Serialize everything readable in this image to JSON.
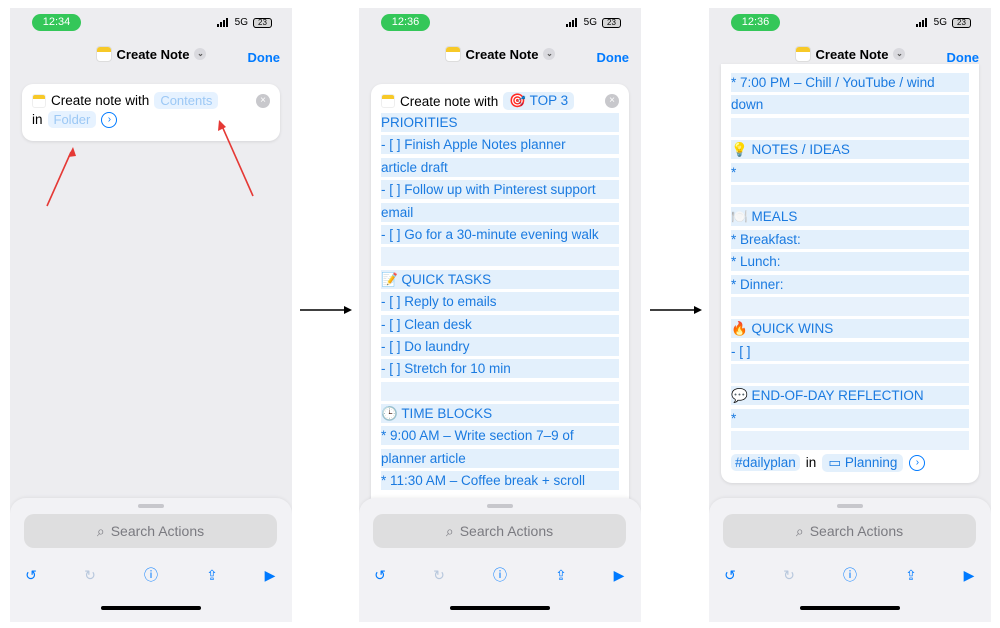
{
  "status": {
    "network": "5G",
    "battery": "23"
  },
  "title": "Create Note",
  "done_label": "Done",
  "search_placeholder": "Search Actions",
  "screens": [
    {
      "time": "12:34",
      "action": {
        "prefix": "Create note with",
        "contents": "Contents",
        "in_label": "in",
        "folder": "Folder"
      }
    },
    {
      "time": "12:36",
      "action": {
        "prefix": "Create note with",
        "first_emoji": "🎯",
        "first_token": "TOP 3"
      },
      "lines": [
        "PRIORITIES",
        "- [ ] Finish Apple Notes planner",
        "article draft",
        "- [ ] Follow up with Pinterest support",
        "email",
        "- [ ] Go for a 30-minute evening walk",
        "",
        "📝 QUICK TASKS",
        "- [ ] Reply to emails",
        "- [ ] Clean desk",
        "- [ ] Do laundry",
        "- [ ] Stretch for 10 min",
        "",
        "🕒 TIME BLOCKS",
        "* 9:00 AM – Write section 7–9 of",
        "planner article",
        "* 11:30 AM – Coffee break + scroll"
      ]
    },
    {
      "time": "12:36",
      "lines": [
        "* 7:00 PM – Chill / YouTube / wind",
        "down",
        "",
        "💡 NOTES / IDEAS",
        "*",
        "",
        "🍽️ MEALS",
        "* Breakfast:",
        "* Lunch:",
        "* Dinner:",
        "",
        "🔥 QUICK WINS",
        "- [ ]",
        "",
        "💬 END-OF-DAY REFLECTION",
        "*",
        ""
      ],
      "footer": {
        "tag": "#dailyplan",
        "in_label": "in",
        "folder": "Planning"
      }
    }
  ]
}
